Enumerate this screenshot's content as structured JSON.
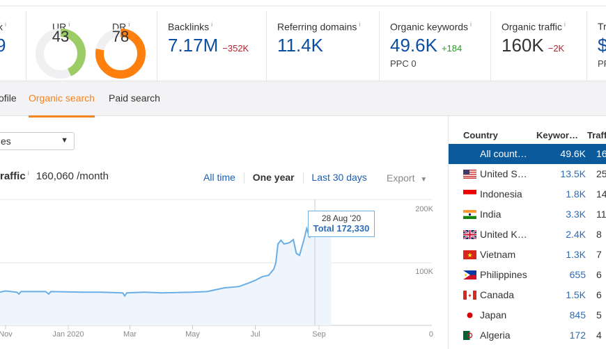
{
  "metrics": {
    "partial_left": {
      "label": "k",
      "value": "9"
    },
    "ur": {
      "label": "UR",
      "value": "43",
      "level": 43,
      "color": "#9ccc65"
    },
    "dr": {
      "label": "DR",
      "value": "78",
      "level": 78,
      "color": "#ff7f0e"
    },
    "backlinks": {
      "label": "Backlinks",
      "value": "7.17M",
      "delta": "−352K"
    },
    "referring_domains": {
      "label": "Referring domains",
      "value": "11.4K"
    },
    "organic_keywords": {
      "label": "Organic keywords",
      "value": "49.6K",
      "delta": "+184",
      "sub": "PPC 0"
    },
    "organic_traffic": {
      "label": "Organic traffic",
      "value": "160K",
      "delta": "−2K"
    },
    "partial_right": {
      "label": "Tr",
      "value": "$",
      "sub": "PF"
    },
    "info_icon": "i"
  },
  "tabs": [
    {
      "label": "ofile"
    },
    {
      "label": "Organic search",
      "active": true
    },
    {
      "label": "Paid search"
    }
  ],
  "filter": {
    "value": "es"
  },
  "chart_header": {
    "title": "raffic",
    "value": "160,060 /month",
    "ranges": [
      "All time",
      "One year",
      "Last 30 days"
    ],
    "active_range": "One year",
    "export": "Export"
  },
  "chart_data": {
    "type": "area",
    "x_ticks": [
      "Nov",
      "Jan 2020",
      "Mar",
      "May",
      "Jul",
      "Sep"
    ],
    "y_ticks": [
      "0",
      "100K",
      "200K"
    ],
    "ylim": [
      0,
      200000
    ],
    "grid": true,
    "color": "#6aaee6",
    "tooltip": {
      "date": "28 Aug '20",
      "label": "Total 172,330"
    },
    "x": [
      "2019-10-26",
      "2019-11-01",
      "2019-11-12",
      "2019-11-14",
      "2019-11-16",
      "2019-12-10",
      "2019-12-13",
      "2019-12-15",
      "2020-01-15",
      "2020-02-01",
      "2020-02-23",
      "2020-02-25",
      "2020-02-27",
      "2020-03-15",
      "2020-04-01",
      "2020-05-01",
      "2020-05-15",
      "2020-06-01",
      "2020-06-15",
      "2020-06-25",
      "2020-07-01",
      "2020-07-08",
      "2020-07-14",
      "2020-07-19",
      "2020-07-21",
      "2020-07-23",
      "2020-07-26",
      "2020-07-29",
      "2020-08-03",
      "2020-08-07",
      "2020-08-10",
      "2020-08-13",
      "2020-08-17",
      "2020-08-20",
      "2020-08-23",
      "2020-08-26",
      "2020-08-28",
      "2020-09-01",
      "2020-09-08",
      "2020-09-13"
    ],
    "values": [
      53000,
      55000,
      53000,
      50000,
      54000,
      54000,
      50000,
      54000,
      53000,
      53000,
      52000,
      47000,
      52000,
      53000,
      52000,
      53000,
      54000,
      60000,
      62000,
      68000,
      72000,
      78000,
      80000,
      90000,
      100000,
      130000,
      136000,
      130000,
      132000,
      137000,
      115000,
      112000,
      135000,
      155000,
      140000,
      170000,
      172330,
      170000,
      168000,
      166000
    ]
  },
  "country_table": {
    "headers": [
      "Country",
      "Keywor…",
      "Traff"
    ],
    "rows": [
      {
        "country": "All count…",
        "keywords": "49.6K",
        "traffic": "16",
        "selected": true
      },
      {
        "country": "United S…",
        "keywords": "13.5K",
        "traffic": "25",
        "flag": "us"
      },
      {
        "country": "Indonesia",
        "keywords": "1.8K",
        "traffic": "14",
        "flag": "id"
      },
      {
        "country": "India",
        "keywords": "3.3K",
        "traffic": "11",
        "flag": "in"
      },
      {
        "country": "United K…",
        "keywords": "2.4K",
        "traffic": "8",
        "flag": "gb"
      },
      {
        "country": "Vietnam",
        "keywords": "1.3K",
        "traffic": "7",
        "flag": "vn"
      },
      {
        "country": "Philippines",
        "keywords": "655",
        "traffic": "6",
        "flag": "ph"
      },
      {
        "country": "Canada",
        "keywords": "1.5K",
        "traffic": "6",
        "flag": "ca"
      },
      {
        "country": "Japan",
        "keywords": "845",
        "traffic": "5",
        "flag": "jp"
      },
      {
        "country": "Algeria",
        "keywords": "172",
        "traffic": "4",
        "flag": "dz"
      }
    ]
  }
}
